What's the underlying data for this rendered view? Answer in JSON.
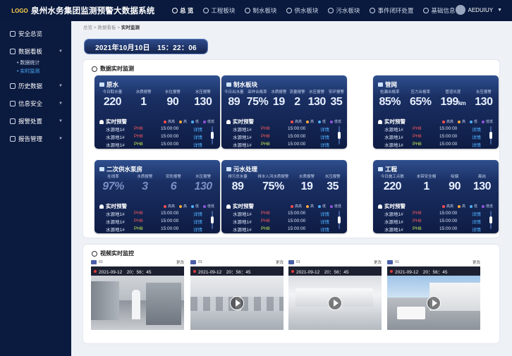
{
  "header": {
    "logo": "LOGO",
    "title": "泉州水务集团监测预警大数据系统",
    "nav": [
      "总 览",
      "工程板块",
      "制水板块",
      "供水板块",
      "污水板块",
      "事件闭环处置",
      "基础信息"
    ],
    "user": "AEDUIUY"
  },
  "sidebar": {
    "items": [
      {
        "label": "安全总览"
      },
      {
        "label": "数据看板",
        "subs": [
          "数据统计",
          "实时监测"
        ]
      },
      {
        "label": "历史数据"
      },
      {
        "label": "信息安全"
      },
      {
        "label": "报警处置"
      },
      {
        "label": "报告管理"
      }
    ]
  },
  "breadcrumb": [
    "总览",
    "数据看板",
    "实时监测"
  ],
  "datetime": "2021年10月10日　15：22：06",
  "monitor_title": "数据实时监测",
  "video_title": "视频实时监控",
  "common": {
    "alert_title": "实时预警",
    "legend": [
      "高高",
      "高",
      "低",
      "低低"
    ],
    "legend_colors": [
      "#ff4d4f",
      "#ffa940",
      "#4fb0ff",
      "#9254de"
    ],
    "rows": [
      {
        "name": "水源地1#",
        "tag": "PH8",
        "tag_color": "#ff5a5a",
        "time": "15:00:00",
        "link": "详情"
      },
      {
        "name": "水源地1#",
        "tag": "PH8",
        "tag_color": "#ff5a5a",
        "time": "15:00:00",
        "link": "详情"
      },
      {
        "name": "水源地1#",
        "tag": "PH8",
        "tag_color": "#c8f050",
        "time": "15:00:00",
        "link": "详情"
      }
    ]
  },
  "cards": [
    {
      "title": "原水",
      "metrics": [
        {
          "label": "今日取水量",
          "value": "220"
        },
        {
          "label": "水质报警",
          "value": "1"
        },
        {
          "label": "水位报警",
          "value": "90"
        },
        {
          "label": "水压报警",
          "value": "130"
        }
      ]
    },
    {
      "title": "制水板块",
      "metrics": [
        {
          "label": "今日出水量",
          "value": "89"
        },
        {
          "label": "采样合格率",
          "value": "75%"
        },
        {
          "label": "水质报警",
          "value": "19"
        },
        {
          "label": "流量报警",
          "value": "2"
        },
        {
          "label": "水压报警",
          "value": "130"
        },
        {
          "label": "安环报警",
          "value": "35"
        }
      ]
    },
    {
      "title": "管网",
      "metrics": [
        {
          "label": "检漏合格率",
          "value": "85%"
        },
        {
          "label": "压力合格率",
          "value": "65%"
        },
        {
          "label": "管道长度",
          "value": "199",
          "unit": "km"
        },
        {
          "label": "水压报警",
          "value": "130"
        }
      ]
    },
    {
      "title": "二次供水泵房",
      "metrics": [
        {
          "label": "在线率",
          "value": "97%"
        },
        {
          "label": "水质报警",
          "value": "3"
        },
        {
          "label": "安防报警",
          "value": "6"
        },
        {
          "label": "水压报警",
          "value": "130"
        }
      ]
    },
    {
      "title": "污水处理",
      "metrics": [
        {
          "label": "排污总水量",
          "value": "89"
        },
        {
          "label": "排水入河水质报警",
          "value": "75%"
        },
        {
          "label": "水质报警",
          "value": "19"
        },
        {
          "label": "水压报警",
          "value": "35"
        }
      ]
    },
    {
      "title": "工程",
      "metrics": [
        {
          "label": "今日施工点数",
          "value": "220"
        },
        {
          "label": "未带安全帽",
          "value": "1"
        },
        {
          "label": "吸烟",
          "value": "90"
        },
        {
          "label": "离岗",
          "value": "130"
        }
      ]
    }
  ],
  "videos": [
    {
      "channel": "01",
      "more": "更改",
      "time": "2021-09-12　20：56：45"
    },
    {
      "channel": "01",
      "more": "更改",
      "time": "2021-09-12　20：56：45"
    },
    {
      "channel": "01",
      "more": "更改",
      "time": "2021-09-12　20：56：45"
    },
    {
      "channel": "01",
      "more": "更改",
      "time": "2021-09-12　20：56：45"
    }
  ]
}
